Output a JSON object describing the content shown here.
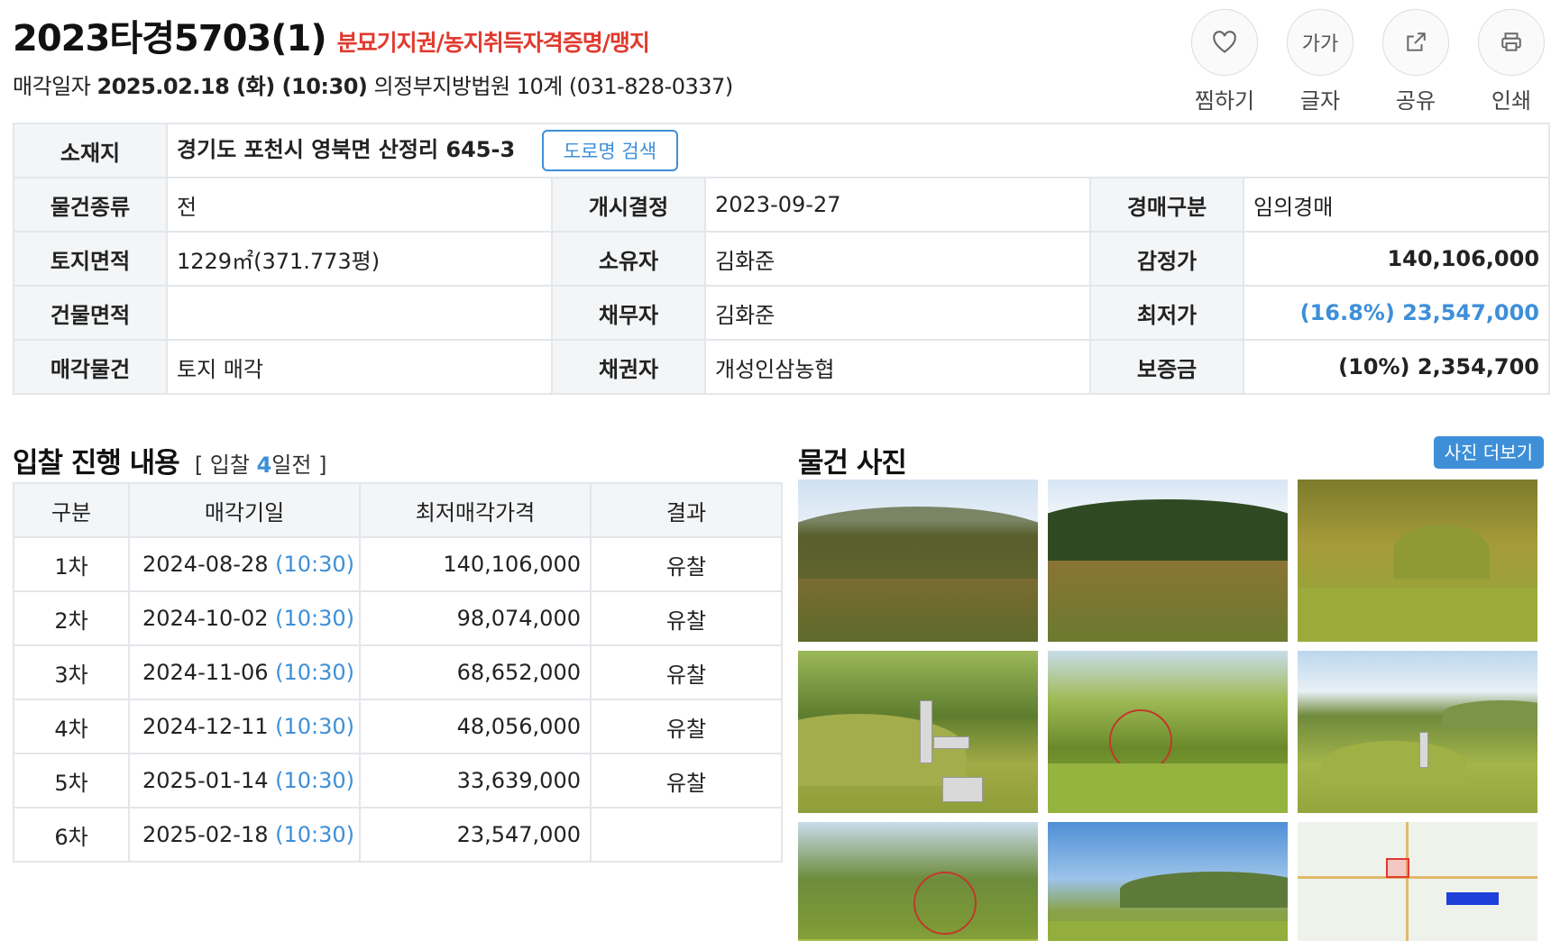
{
  "header": {
    "case_no": "2023타경5703(1)",
    "case_tags": "분묘기지권/농지취득자격증명/맹지",
    "sale_label": "매각일자",
    "sale_datetime": "2025.02.18 (화) (10:30)",
    "court": "의정부지방법원 10계 (031-828-0337)"
  },
  "actions": [
    {
      "label": "찜하기",
      "icon": "heart-icon"
    },
    {
      "label": "글자",
      "icon": "font-size-icon",
      "glyph": "가가"
    },
    {
      "label": "공유",
      "icon": "share-icon"
    },
    {
      "label": "인쇄",
      "icon": "print-icon"
    }
  ],
  "info": {
    "location_label": "소재지",
    "location": "경기도 포천시 영북면 산정리 645-3",
    "road_search": "도로명 검색",
    "rows": [
      {
        "l1": "물건종류",
        "v1": "전",
        "l2": "개시결정",
        "v2": "2023-09-27",
        "l3": "경매구분",
        "v3": "임의경매"
      },
      {
        "l1": "토지면적",
        "v1": "1229㎡(371.773평)",
        "l2": "소유자",
        "v2": "김화준",
        "l3": "감정가",
        "v3": "140,106,000"
      },
      {
        "l1": "건물면적",
        "v1": "",
        "l2": "채무자",
        "v2": "김화준",
        "l3": "최저가",
        "v3": "(16.8%) 23,547,000"
      },
      {
        "l1": "매각물건",
        "v1": "토지 매각",
        "l2": "채권자",
        "v2": "개성인삼농협",
        "l3": "보증금",
        "v3": "(10%) 2,354,700"
      }
    ]
  },
  "bidding": {
    "title": "입찰 진행 내용",
    "count_prefix": "[ 입찰 ",
    "count": "4",
    "count_suffix": "일전 ]",
    "columns": [
      "구분",
      "매각기일",
      "최저매각가격",
      "결과"
    ],
    "rows": [
      {
        "round": "1차",
        "date": "2024-08-28",
        "time": "(10:30)",
        "price": "140,106,000",
        "result": "유찰"
      },
      {
        "round": "2차",
        "date": "2024-10-02",
        "time": "(10:30)",
        "price": "98,074,000",
        "result": "유찰"
      },
      {
        "round": "3차",
        "date": "2024-11-06",
        "time": "(10:30)",
        "price": "68,652,000",
        "result": "유찰"
      },
      {
        "round": "4차",
        "date": "2024-12-11",
        "time": "(10:30)",
        "price": "48,056,000",
        "result": "유찰"
      },
      {
        "round": "5차",
        "date": "2025-01-14",
        "time": "(10:30)",
        "price": "33,639,000",
        "result": "유찰"
      },
      {
        "round": "6차",
        "date": "2025-02-18",
        "time": "(10:30)",
        "price": "23,547,000",
        "result": ""
      }
    ]
  },
  "photos": {
    "title": "물건 사진",
    "more": "사진 더보기"
  },
  "colors": {
    "accent": "#3e8fd8",
    "warning": "#e03a2f",
    "label_bg": "#f3f5f7",
    "border": "#e3e6ea"
  }
}
